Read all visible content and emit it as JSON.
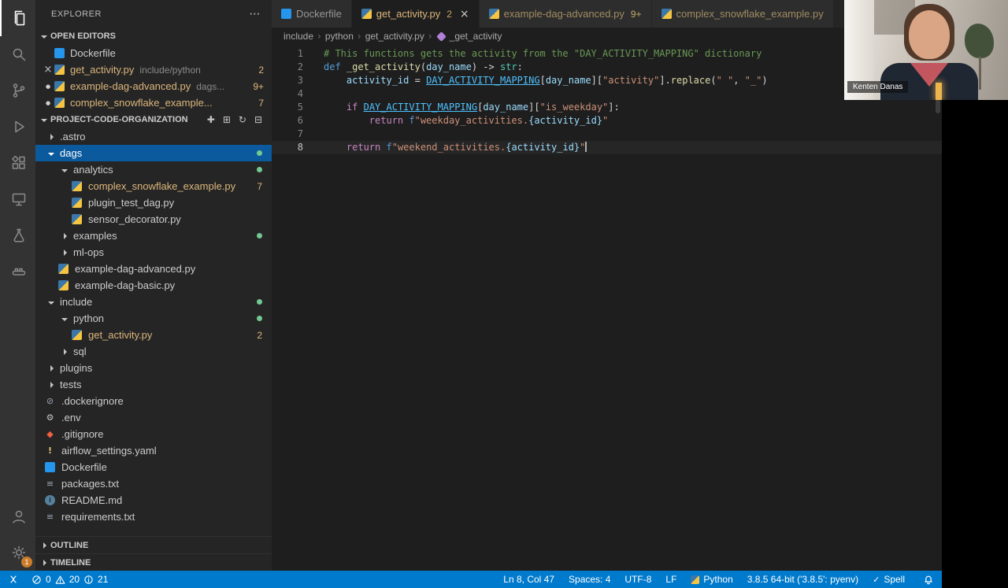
{
  "activity_bar": {
    "items": [
      "explorer",
      "search",
      "source-control",
      "run-and-debug",
      "extensions",
      "remote-explorer",
      "testing",
      "docker"
    ],
    "bottom": [
      "account",
      "settings"
    ],
    "settings_badge": "1"
  },
  "sidebar": {
    "title": "EXPLORER",
    "title_actions_icon": "more-actions",
    "open_editors": {
      "header": "OPEN EDITORS",
      "items": [
        {
          "lead": "none",
          "icon": "docker",
          "label": "Dockerfile"
        },
        {
          "lead": "close",
          "icon": "python",
          "label": "get_activity.py",
          "desc": "include/python",
          "badge": "2",
          "modified": true
        },
        {
          "lead": "dot",
          "icon": "python",
          "label": "example-dag-advanced.py",
          "desc": "dags...",
          "badge": "9+",
          "modified": true
        },
        {
          "lead": "dot",
          "icon": "python",
          "label": "complex_snowflake_example...",
          "badge": "7",
          "modified": true
        }
      ]
    },
    "project": {
      "header": "PROJECT-CODE-ORGANIZATION",
      "actions": [
        "new-file-icon",
        "new-folder-icon",
        "refresh-icon",
        "collapse-all-icon"
      ],
      "tree": [
        {
          "l": 0,
          "t": "folder",
          "ch": "right",
          "label": ".astro"
        },
        {
          "l": 0,
          "t": "folder",
          "ch": "down",
          "label": "dags",
          "selected": true,
          "dot": true
        },
        {
          "l": 1,
          "t": "folder",
          "ch": "down",
          "label": "analytics",
          "dot": true
        },
        {
          "l": 2,
          "t": "file",
          "icon": "python",
          "label": "complex_snowflake_example.py",
          "badge": "7",
          "modified": true
        },
        {
          "l": 2,
          "t": "file",
          "icon": "python",
          "label": "plugin_test_dag.py"
        },
        {
          "l": 2,
          "t": "file",
          "icon": "python",
          "label": "sensor_decorator.py"
        },
        {
          "l": 1,
          "t": "folder",
          "ch": "right",
          "label": "examples",
          "dot": true
        },
        {
          "l": 1,
          "t": "folder",
          "ch": "right",
          "label": "ml-ops"
        },
        {
          "l": 1,
          "t": "file",
          "icon": "python",
          "label": "example-dag-advanced.py"
        },
        {
          "l": 1,
          "t": "file",
          "icon": "python",
          "label": "example-dag-basic.py"
        },
        {
          "l": 0,
          "t": "folder",
          "ch": "down",
          "label": "include",
          "dot": true
        },
        {
          "l": 1,
          "t": "folder",
          "ch": "down",
          "label": "python",
          "dot": true
        },
        {
          "l": 2,
          "t": "file",
          "icon": "python",
          "label": "get_activity.py",
          "badge": "2",
          "modified": true
        },
        {
          "l": 1,
          "t": "folder",
          "ch": "right",
          "label": "sql"
        },
        {
          "l": 0,
          "t": "folder",
          "ch": "right",
          "label": "plugins"
        },
        {
          "l": 0,
          "t": "folder",
          "ch": "right",
          "label": "tests"
        },
        {
          "l": 0,
          "t": "file",
          "icon": "ignore",
          "label": ".dockerignore"
        },
        {
          "l": 0,
          "t": "file",
          "icon": "gear",
          "label": ".env"
        },
        {
          "l": 0,
          "t": "file",
          "icon": "git",
          "label": ".gitignore"
        },
        {
          "l": 0,
          "t": "file",
          "icon": "warn",
          "label": "airflow_settings.yaml"
        },
        {
          "l": 0,
          "t": "file",
          "icon": "docker",
          "label": "Dockerfile"
        },
        {
          "l": 0,
          "t": "file",
          "icon": "txt",
          "label": "packages.txt"
        },
        {
          "l": 0,
          "t": "file",
          "icon": "md",
          "label": "README.md"
        },
        {
          "l": 0,
          "t": "file",
          "icon": "txt",
          "label": "requirements.txt"
        }
      ]
    },
    "outline_header": "OUTLINE",
    "timeline_header": "TIMELINE"
  },
  "tabs": [
    {
      "icon": "docker",
      "label": "Dockerfile",
      "active": false
    },
    {
      "icon": "python",
      "label": "get_activity.py",
      "badge": "2",
      "active": true,
      "close": true,
      "modified": true
    },
    {
      "icon": "python",
      "label": "example-dag-advanced.py",
      "badge": "9+",
      "active": false,
      "modified": true
    },
    {
      "icon": "python",
      "label": "complex_snowflake_example.py",
      "active": false,
      "modified": true
    }
  ],
  "breadcrumb": {
    "path": [
      "include",
      "python",
      "get_activity.py"
    ],
    "symbol": "_get_activity"
  },
  "editor": {
    "lines": [
      {
        "tokens": [
          [
            "c",
            "# This functions gets the activity from the \"DAY_ACTIVITY_MAPPING\" dictionary"
          ]
        ]
      },
      {
        "tokens": [
          [
            "k",
            "def "
          ],
          [
            "f",
            "_get_activity"
          ],
          [
            "p",
            "("
          ],
          [
            "v",
            "day_name"
          ],
          [
            "p",
            ") -> "
          ],
          [
            "t",
            "str"
          ],
          [
            "p",
            ":"
          ]
        ]
      },
      {
        "tokens": [
          [
            "p",
            "    "
          ],
          [
            "v",
            "activity_id"
          ],
          [
            "p",
            " = "
          ],
          [
            "u",
            "DAY_ACTIVITY_MAPPING"
          ],
          [
            "p",
            "["
          ],
          [
            "v",
            "day_name"
          ],
          [
            "p",
            "]["
          ],
          [
            "s",
            "\"activity\""
          ],
          [
            "p",
            "]."
          ],
          [
            "f",
            "replace"
          ],
          [
            "p",
            "("
          ],
          [
            "s",
            "\" \""
          ],
          [
            "p",
            ", "
          ],
          [
            "s",
            "\"_\""
          ],
          [
            "p",
            ")"
          ]
        ]
      },
      {
        "tokens": []
      },
      {
        "tokens": [
          [
            "p",
            "    "
          ],
          [
            "q",
            "if "
          ],
          [
            "u",
            "DAY_ACTIVITY_MAPPING"
          ],
          [
            "p",
            "["
          ],
          [
            "v",
            "day_name"
          ],
          [
            "p",
            "]["
          ],
          [
            "s",
            "\"is_weekday\""
          ],
          [
            "p",
            "]:"
          ]
        ]
      },
      {
        "tokens": [
          [
            "p",
            "        "
          ],
          [
            "q",
            "return "
          ],
          [
            "k",
            "f"
          ],
          [
            "s",
            "\"weekday_activities."
          ],
          [
            "v",
            "{activity_id}"
          ],
          [
            "s",
            "\""
          ]
        ]
      },
      {
        "tokens": []
      },
      {
        "tokens": [
          [
            "p",
            "    "
          ],
          [
            "q",
            "return "
          ],
          [
            "k",
            "f"
          ],
          [
            "s",
            "\"weekend_activities."
          ],
          [
            "v",
            "{activity_id}"
          ],
          [
            "s",
            "\""
          ]
        ],
        "cursor": true
      }
    ]
  },
  "webcam": {
    "label": "Kenten Danas"
  },
  "status_bar": {
    "problems": {
      "errors": "0",
      "warnings": "20",
      "infos": "21"
    },
    "right": [
      {
        "name": "cursor-position",
        "label": "Ln 8, Col 47"
      },
      {
        "name": "indentation",
        "label": "Spaces: 4"
      },
      {
        "name": "encoding",
        "label": "UTF-8"
      },
      {
        "name": "eol",
        "label": "LF"
      },
      {
        "name": "language",
        "label": "Python"
      },
      {
        "name": "interpreter",
        "label": "3.8.5 64-bit ('3.8.5': pyenv)"
      },
      {
        "name": "spell",
        "label": "Spell"
      }
    ]
  },
  "colors": {
    "accent": "#007acc",
    "modified": "#dcb67a",
    "added_dot": "#73c991",
    "selection": "#0b5a9e"
  }
}
